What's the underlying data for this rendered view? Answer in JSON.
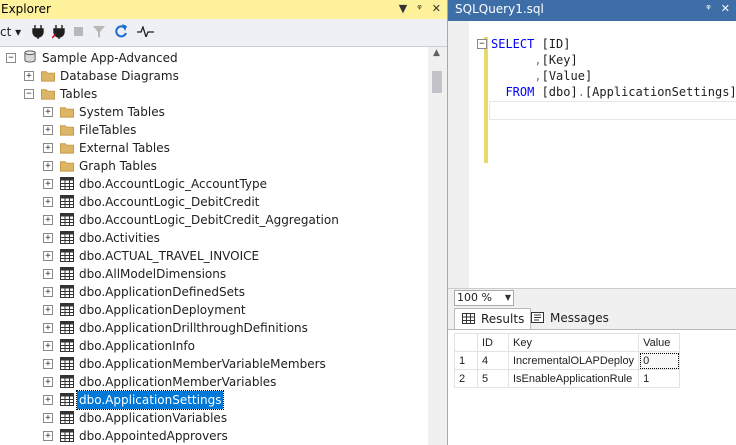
{
  "explorer": {
    "title": "Explorer",
    "title_buttons": [
      "▼",
      "ᵠ",
      "✕"
    ],
    "toolbar": {
      "connect_label": "ct ▾",
      "icons": [
        "connect-plug-icon",
        "disconnect-plug-icon",
        "stop-icon",
        "filter-icon",
        "refresh-icon",
        "activity-monitor-icon"
      ]
    },
    "tree": [
      {
        "label": "Sample App-Advanced",
        "level": 0,
        "expander": "−",
        "icon": "database"
      },
      {
        "label": "Database Diagrams",
        "level": 1,
        "expander": "+",
        "icon": "folder"
      },
      {
        "label": "Tables",
        "level": 1,
        "expander": "−",
        "icon": "folder"
      },
      {
        "label": "System Tables",
        "level": 2,
        "expander": "+",
        "icon": "folder"
      },
      {
        "label": "FileTables",
        "level": 2,
        "expander": "+",
        "icon": "folder"
      },
      {
        "label": "External Tables",
        "level": 2,
        "expander": "+",
        "icon": "folder"
      },
      {
        "label": "Graph Tables",
        "level": 2,
        "expander": "+",
        "icon": "folder"
      },
      {
        "label": "dbo.AccountLogic_AccountType",
        "level": 2,
        "expander": "+",
        "icon": "table"
      },
      {
        "label": "dbo.AccountLogic_DebitCredit",
        "level": 2,
        "expander": "+",
        "icon": "table"
      },
      {
        "label": "dbo.AccountLogic_DebitCredit_Aggregation",
        "level": 2,
        "expander": "+",
        "icon": "table"
      },
      {
        "label": "dbo.Activities",
        "level": 2,
        "expander": "+",
        "icon": "table"
      },
      {
        "label": "dbo.ACTUAL_TRAVEL_INVOICE",
        "level": 2,
        "expander": "+",
        "icon": "table"
      },
      {
        "label": "dbo.AllModelDimensions",
        "level": 2,
        "expander": "+",
        "icon": "table"
      },
      {
        "label": "dbo.ApplicationDefinedSets",
        "level": 2,
        "expander": "+",
        "icon": "table"
      },
      {
        "label": "dbo.ApplicationDeployment",
        "level": 2,
        "expander": "+",
        "icon": "table"
      },
      {
        "label": "dbo.ApplicationDrillthroughDefinitions",
        "level": 2,
        "expander": "+",
        "icon": "table"
      },
      {
        "label": "dbo.ApplicationInfo",
        "level": 2,
        "expander": "+",
        "icon": "table"
      },
      {
        "label": "dbo.ApplicationMemberVariableMembers",
        "level": 2,
        "expander": "+",
        "icon": "table"
      },
      {
        "label": "dbo.ApplicationMemberVariables",
        "level": 2,
        "expander": "+",
        "icon": "table"
      },
      {
        "label": "dbo.ApplicationSettings",
        "level": 2,
        "expander": "+",
        "icon": "table",
        "selected": true
      },
      {
        "label": "dbo.ApplicationVariables",
        "level": 2,
        "expander": "+",
        "icon": "table"
      },
      {
        "label": "dbo.AppointedApprovers",
        "level": 2,
        "expander": "+",
        "icon": "table"
      }
    ]
  },
  "query": {
    "tab_title": "SQLQuery1.sql",
    "tab_buttons": [
      "ᵠ",
      "✕"
    ],
    "code": {
      "l1_kw": "SELECT",
      "l1_rest": " [ID]",
      "l2_comma": ",",
      "l2_rest": "[Key]",
      "l3_comma": ",",
      "l3_rest": "[Value]",
      "l4_kw": "FROM",
      "l4_a": " [dbo]",
      "l4_dot": ".",
      "l4_b": "[ApplicationSettings]"
    },
    "zoom": "100 %",
    "results_tabs": {
      "results": "Results",
      "messages": "Messages"
    },
    "grid": {
      "headers": [
        "",
        "ID",
        "Key",
        "Value"
      ],
      "rows": [
        [
          "1",
          "4",
          "IncrementalOLAPDeploy",
          "0"
        ],
        [
          "2",
          "5",
          "IsEnableApplicationRule",
          "1"
        ]
      ]
    }
  }
}
